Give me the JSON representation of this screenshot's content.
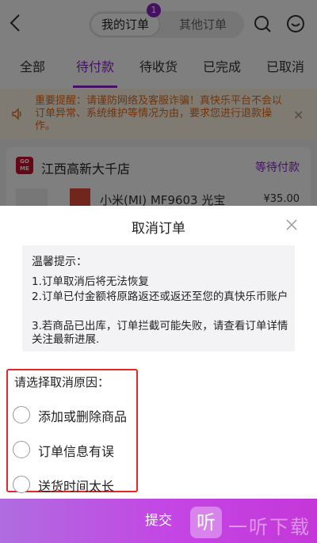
{
  "header": {
    "tab_my_orders": "我的订单",
    "tab_other_orders": "其他订单",
    "badge_count": "1"
  },
  "tabs": [
    "全部",
    "待付款",
    "待收货",
    "已完成",
    "已取消"
  ],
  "notice": {
    "text": "重要提醒：请谨防网络及客服诈骗！真快乐平台不会以订单异常、系统维护等情况为由，要求您进行退款操作。"
  },
  "store": {
    "logo_text": "GO ME",
    "name": "江西高新大千店",
    "status": "等待付款",
    "product_name": "小米(MI) MF9603 光宝",
    "product_price": "¥35.00"
  },
  "dialog": {
    "title": "取消订单",
    "tips_title": "温馨提示：",
    "tips": [
      "1.订单取消后将无法恢复",
      " 2.订单已付金额将原路返还或返还至您的真快乐币账户",
      " 3.若商品已出库，订单拦截可能失败，请查看订单详情关注最新进展."
    ],
    "reason_title": "请选择取消原因：",
    "reasons": [
      "添加或删除商品",
      "订单信息有误",
      "送货时间太长"
    ],
    "submit_label": "提交"
  },
  "watermark": {
    "icon_char": "听",
    "text": "一听下载"
  },
  "colors": {
    "accent": "#8c21c9",
    "notice_text": "#e06a1b",
    "highlight_border": "#e8262a"
  }
}
